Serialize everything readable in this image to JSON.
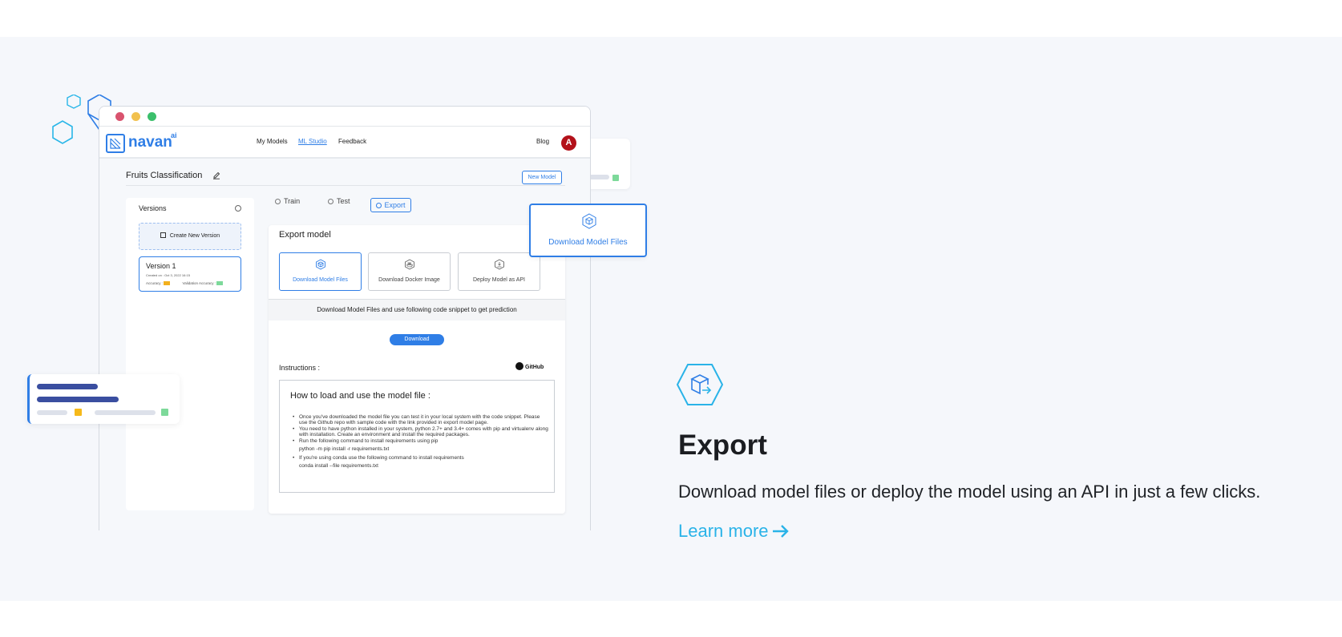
{
  "colors": {
    "accent": "#2f7ee6",
    "link": "#2ab3e8",
    "band_bg": "#f5f7fb",
    "avatar": "#b3111a"
  },
  "browser": {
    "traffic_lights": [
      "#d9536e",
      "#f2c14e",
      "#3bbf6b"
    ],
    "brand": {
      "name": "navan",
      "sup": "ai"
    },
    "nav": {
      "my_models": "My Models",
      "ml_studio": "ML Studio",
      "feedback": "Feedback",
      "blog": "Blog",
      "avatar_letter": "A"
    },
    "model_title": "Fruits Classification",
    "new_model_button": "New Model",
    "versions": {
      "title": "Versions",
      "create_label": "Create New Version",
      "card": {
        "name": "Version 1",
        "created": "Created on : Oct 3, 2022  16:15",
        "accuracy": "Accuracy :",
        "validation_accuracy": "Validation Accuracy :"
      }
    },
    "tabs": {
      "train": "Train",
      "test": "Test",
      "export": "Export"
    },
    "export": {
      "title": "Export model",
      "options": [
        "Download Model Files",
        "Download Docker Image",
        "Deploy Model as API"
      ],
      "snippet_text": "Download Model Files and use following code snippet to get prediction",
      "download_button": "Download",
      "instructions_label": "Instructions :",
      "github_label": "GitHub",
      "code_heading": "How to load and use the model file :",
      "bullet_1": "Once you've downloaded the model file you can test it in your local system with the code snippet. Please use the Github repo with sample code with the link provided in export model page.",
      "bullet_2": "You need to have python installed in your system, python 2.7+ and 3.4+ comes with pip and virtualenv along with installation. Create an environment and install the required packages.",
      "bullet_3": "Run the following command to install requirements using pip",
      "cmd_1": "python -m pip install -r requirements.txt",
      "bullet_4": "If you're using conda use the following command to install requirements",
      "cmd_2": "conda install --file requirements.txt"
    }
  },
  "floating_card": {
    "label": "Download Model Files"
  },
  "feature": {
    "icon": "box-export-icon",
    "title": "Export",
    "description": "Download model files or deploy the model using an API in just a few clicks.",
    "learn_more": "Learn more"
  }
}
